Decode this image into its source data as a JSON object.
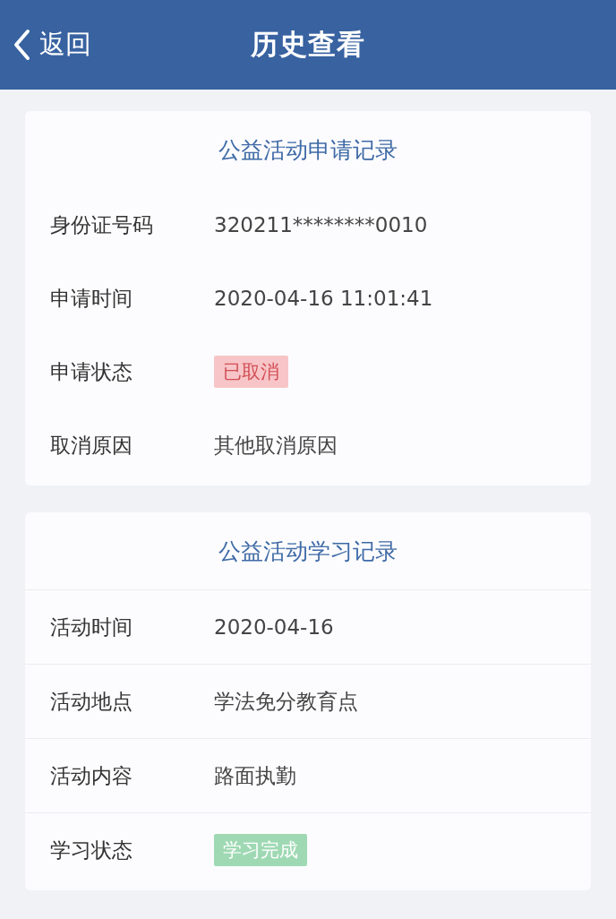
{
  "header": {
    "back_label": "返回",
    "title": "历史查看"
  },
  "sections": [
    {
      "title": "公益活动申请记录",
      "divided": false,
      "rows": [
        {
          "label": "身份证号码",
          "kind": "text",
          "value": "320211********0010"
        },
        {
          "label": "申请时间",
          "kind": "text",
          "value": "2020-04-16 11:01:41"
        },
        {
          "label": "申请状态",
          "kind": "cancelled",
          "value": "已取消"
        },
        {
          "label": "取消原因",
          "kind": "text",
          "value": "其他取消原因"
        }
      ]
    },
    {
      "title": "公益活动学习记录",
      "divided": true,
      "rows": [
        {
          "label": "活动时间",
          "kind": "text",
          "value": "2020-04-16"
        },
        {
          "label": "活动地点",
          "kind": "text",
          "value": "学法免分教育点"
        },
        {
          "label": "活动内容",
          "kind": "text",
          "value": "路面执勤"
        },
        {
          "label": "学习状态",
          "kind": "completed",
          "value": "学习完成"
        }
      ]
    }
  ]
}
